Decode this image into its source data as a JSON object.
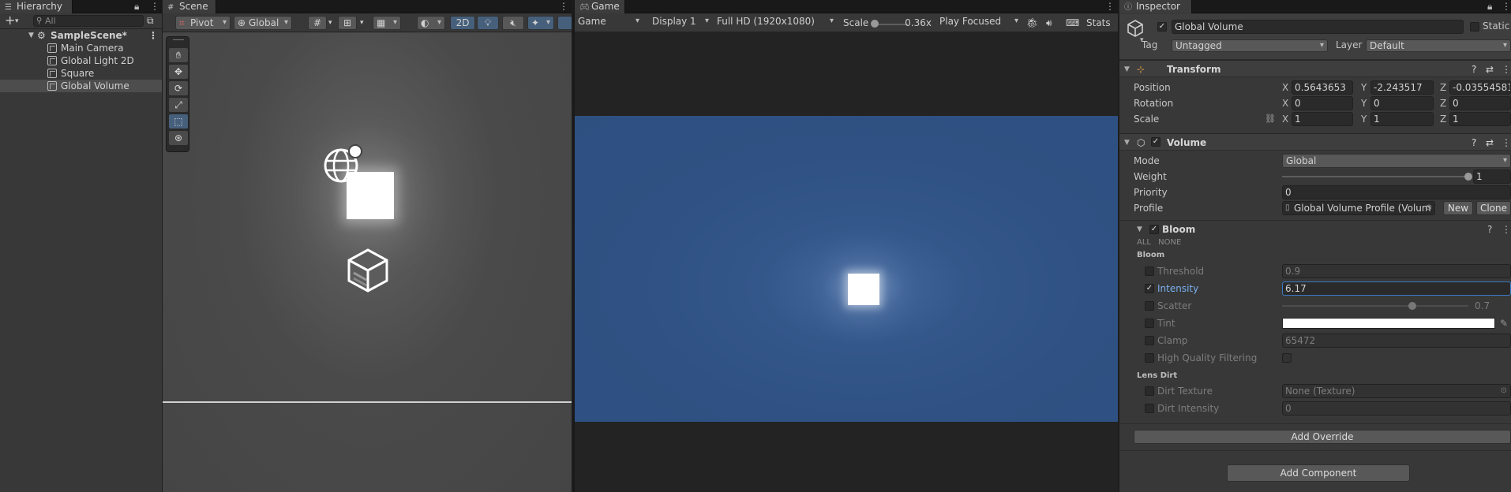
{
  "hierarchy": {
    "tab": "Hierarchy",
    "search_placeholder": "All",
    "scene_name": "SampleScene*",
    "items": [
      {
        "label": "Main Camera"
      },
      {
        "label": "Global Light 2D"
      },
      {
        "label": "Square"
      },
      {
        "label": "Global Volume"
      }
    ]
  },
  "scene": {
    "tab": "Scene",
    "pivot": "Pivot",
    "space": "Global",
    "mode_2d": "2D"
  },
  "game": {
    "tab": "Game",
    "view_select": "Game",
    "display": "Display 1",
    "resolution": "Full HD (1920x1080)",
    "scale_label": "Scale",
    "scale_value": "0.36x",
    "play_mode": "Play Focused",
    "stats": "Stats",
    "scale_fraction": 0.0
  },
  "inspector": {
    "tab": "Inspector",
    "object_name": "Global Volume",
    "static_label": "Static",
    "tag_label": "Tag",
    "tag_value": "Untagged",
    "layer_label": "Layer",
    "layer_value": "Default",
    "transform": {
      "title": "Transform",
      "position_label": "Position",
      "rotation_label": "Rotation",
      "scale_label": "Scale",
      "position": {
        "x": "0.5643653",
        "y": "-2.243517",
        "z": "-0.03554581"
      },
      "rotation": {
        "x": "0",
        "y": "0",
        "z": "0"
      },
      "scale": {
        "x": "1",
        "y": "1",
        "z": "1"
      }
    },
    "volume": {
      "title": "Volume",
      "mode_label": "Mode",
      "mode_value": "Global",
      "weight_label": "Weight",
      "weight_value": "1",
      "weight_fraction": 1.0,
      "priority_label": "Priority",
      "priority_value": "0",
      "profile_label": "Profile",
      "profile_value": "Global Volume Profile (Volum",
      "new_button": "New",
      "clone_button": "Clone"
    },
    "bloom": {
      "title": "Bloom",
      "all": "ALL",
      "none": "NONE",
      "group_bloom": "Bloom",
      "threshold_label": "Threshold",
      "threshold_value": "0.9",
      "intensity_label": "Intensity",
      "intensity_value": "6.17",
      "scatter_label": "Scatter",
      "scatter_value": "0.7",
      "scatter_fraction": 0.7,
      "tint_label": "Tint",
      "tint_color": "#ffffff",
      "clamp_label": "Clamp",
      "clamp_value": "65472",
      "hq_label": "High Quality Filtering",
      "group_lens": "Lens Dirt",
      "dirt_texture_label": "Dirt Texture",
      "dirt_texture_value": "None (Texture)",
      "dirt_intensity_label": "Dirt Intensity",
      "dirt_intensity_value": "0"
    },
    "add_override": "Add Override",
    "add_component": "Add Component"
  },
  "colors": {
    "accent_blue": "#46607c",
    "game_background": "#2f5183",
    "intensity_label_color": "#7ab0f0"
  }
}
